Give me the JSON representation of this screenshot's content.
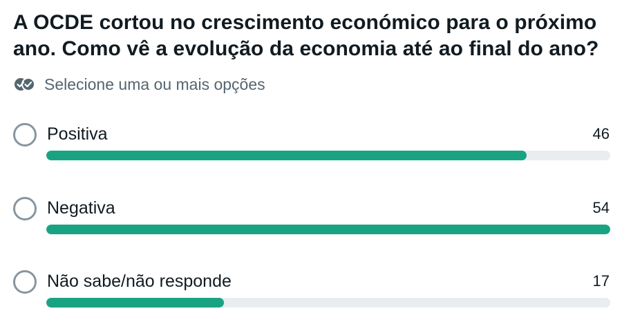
{
  "poll": {
    "question": "A OCDE cortou no crescimento económico para o próximo ano. Como vê a evolução da economia até ao final do ano?",
    "hint": "Selecione uma ou mais opções",
    "accent_color": "#1aa383",
    "track_color": "#e9edef",
    "options": [
      {
        "label": "Positiva",
        "votes": "46",
        "fraction": 0.8519
      },
      {
        "label": "Negativa",
        "votes": "54",
        "fraction": 1.0
      },
      {
        "label": "Não sabe/não responde",
        "votes": "17",
        "fraction": 0.3148
      }
    ]
  }
}
